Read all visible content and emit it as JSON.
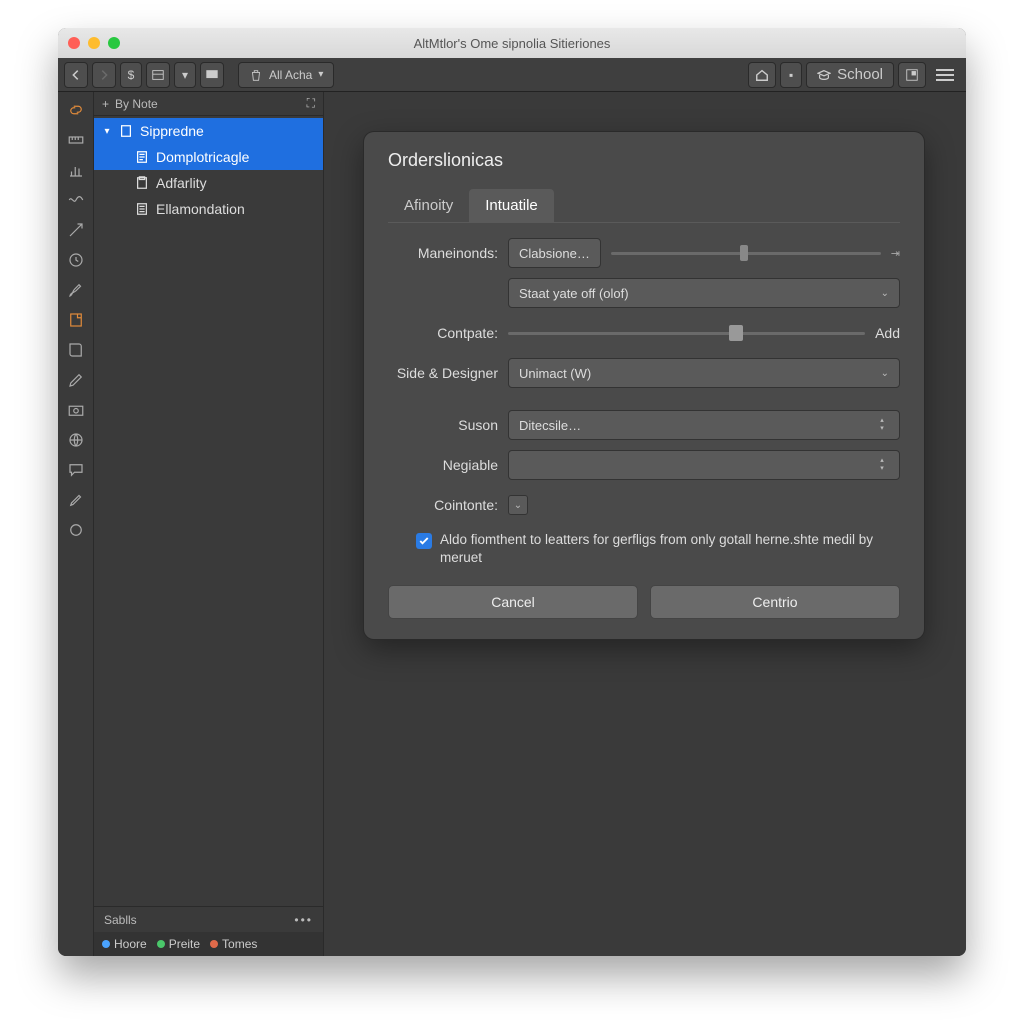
{
  "window": {
    "title": "AltMtlor's Ome sipnolia Sitieriones"
  },
  "toolbar": {
    "breadcrumb": "All Acha",
    "school_label": "School"
  },
  "sidebar": {
    "header": "By Note",
    "items": [
      {
        "label": "Sippredne",
        "selected": true
      },
      {
        "label": "Domplotricagle",
        "selected": true
      },
      {
        "label": "Adfarlity",
        "selected": false
      },
      {
        "label": "Ellamondation",
        "selected": false
      }
    ],
    "footer_label": "Sablls",
    "tags": [
      "Hoore",
      "Preite",
      "Tomes"
    ]
  },
  "dialog": {
    "title": "Orderslionicas",
    "tabs": [
      "Afinoity",
      "Intuatile"
    ],
    "active_tab": 1,
    "rows": {
      "maneionds_label": "Maneinonds:",
      "maneionds_value": "Clabsione…",
      "staat_value": "Staat yate off (olof)",
      "contpate_label": "Contpate:",
      "contpate_add": "Add",
      "side_label": "Side & Designer",
      "side_value": "Unimact (W)",
      "suson_label": "Suson",
      "suson_value": "Ditecsile…",
      "negiable_label": "Negiable",
      "negiable_value": "",
      "cointonte_label": "Cointonte:"
    },
    "checkbox_label": "Aldo fiomthent to leatters for gerfligs from only gotall herne.shte medil by meruet",
    "cancel": "Cancel",
    "confirm": "Centrio"
  }
}
